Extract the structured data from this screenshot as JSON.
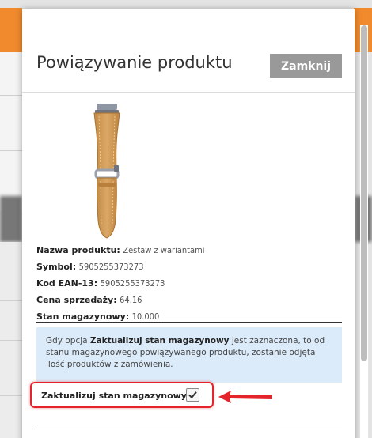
{
  "modal": {
    "title": "Powiązywanie produktu",
    "close_label": "Zamknij"
  },
  "product": {
    "name_label": "Nazwa produktu:",
    "name_value": "Zestaw z wariantami",
    "symbol_label": "Symbol:",
    "symbol_value": "5905255373273",
    "ean_label": "Kod EAN-13:",
    "ean_value": "5905255373273",
    "price_label": "Cena sprzedaży:",
    "price_value": "64.16",
    "stock_label": "Stan magazynowy:",
    "stock_value": "10.000",
    "image_icon": "watch-strap-image"
  },
  "notice": {
    "before": "Gdy opcja ",
    "bold": "Zaktualizuj stan magazynowy",
    "after": " jest zaznaczona, to od stanu magazynowego powiązywanego produktu, zostanie odjęta ilość produktów z zamówienia."
  },
  "update_stock": {
    "label": "Zaktualizuj stan magazynowy",
    "checked": true
  },
  "colors": {
    "highlight": "#e3242b",
    "notice_bg": "#dcebfa",
    "close_bg": "#999999",
    "accent": "#f08a2c"
  }
}
